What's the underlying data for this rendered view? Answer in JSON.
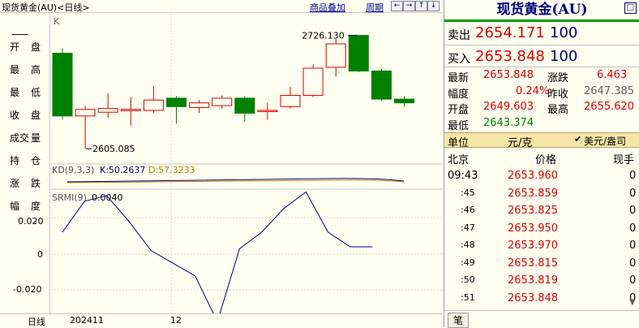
{
  "header": {
    "title": "现货黄金(AU)<日线>",
    "overlay_link": "商品叠加",
    "period_link": "周期",
    "nav_buttons": [
      "←",
      "→",
      "↑",
      "↓",
      "□"
    ]
  },
  "left_panel": {
    "top_label": "K",
    "dash": "------",
    "rows": [
      [
        "开",
        "盘"
      ],
      [
        "最",
        "高"
      ],
      [
        "最",
        "低"
      ],
      [
        "收",
        "盘"
      ],
      [
        "成交",
        "量"
      ],
      [
        "持",
        "仓"
      ],
      [
        "涨",
        "跌"
      ],
      [
        "幅",
        "度"
      ]
    ]
  },
  "bottom_bar": {
    "period_label": "日线",
    "date_label_1": "202411",
    "date_label_2": "12"
  },
  "kline": {
    "high_label": "2726.130",
    "low_label": "2605.085",
    "candles": [
      {
        "o": 2707,
        "h": 2712,
        "l": 2636,
        "c": 2640
      },
      {
        "o": 2640,
        "h": 2651,
        "l": 2605,
        "c": 2647
      },
      {
        "o": 2644,
        "h": 2664,
        "l": 2638,
        "c": 2648
      },
      {
        "o": 2646,
        "h": 2660,
        "l": 2630,
        "c": 2647
      },
      {
        "o": 2646,
        "h": 2672,
        "l": 2643,
        "c": 2657
      },
      {
        "o": 2659,
        "h": 2661,
        "l": 2632,
        "c": 2650
      },
      {
        "o": 2649,
        "h": 2657,
        "l": 2643,
        "c": 2654
      },
      {
        "o": 2651,
        "h": 2662,
        "l": 2648,
        "c": 2659
      },
      {
        "o": 2659,
        "h": 2661,
        "l": 2634,
        "c": 2643
      },
      {
        "o": 2645,
        "h": 2654,
        "l": 2636,
        "c": 2646
      },
      {
        "o": 2650,
        "h": 2671,
        "l": 2648,
        "c": 2662
      },
      {
        "o": 2662,
        "h": 2695,
        "l": 2660,
        "c": 2691
      },
      {
        "o": 2692,
        "h": 2722,
        "l": 2682,
        "c": 2717
      },
      {
        "o": 2726,
        "h": 2726,
        "l": 2687,
        "c": 2688
      },
      {
        "o": 2688,
        "h": 2690,
        "l": 2656,
        "c": 2658
      },
      {
        "o": 2658,
        "h": 2661,
        "l": 2650,
        "c": 2654
      }
    ]
  },
  "kd": {
    "label": "KD(9,3,3)",
    "k_label": "K:50.2637",
    "d_label": "D:57.3233"
  },
  "srmi": {
    "label": "SRMI(9)",
    "value_label": "0.0040",
    "y_ticks": [
      "0.020",
      "0",
      "-0.020"
    ],
    "values": [
      0.012,
      0.029,
      0.032,
      0.018,
      0.002,
      -0.005,
      -0.012,
      -0.037,
      0.003,
      0.012,
      0.025,
      0.034,
      0.012,
      0.004,
      0.004
    ]
  },
  "quote": {
    "title": "现货黄金(AU)",
    "sell_label": "卖出",
    "sell_price": "2654.171",
    "sell_qty": "100",
    "buy_label": "买入",
    "buy_price": "2653.848",
    "buy_qty": "100",
    "latest_label": "最新",
    "latest": "2653.848",
    "change_label": "涨跌",
    "change": "6.463",
    "pct_label": "幅度",
    "pct": "0.24%",
    "prev_label": "昨收",
    "prev": "2647.385",
    "open_label": "开盘",
    "open": "2649.603",
    "high_label": "最高",
    "high": "2655.620",
    "low_label": "最低",
    "low": "2643.374",
    "unit_label": "单位",
    "unit": "元/克",
    "unit_option": "美元/盎司",
    "col_market": "北京",
    "col_price": "价格",
    "col_qty": "现手",
    "ticks": [
      {
        "time": "09:43",
        "price": "2653.960",
        "qty": "0"
      },
      {
        "time": ":45",
        "price": "2653.859",
        "qty": "0"
      },
      {
        "time": ":46",
        "price": "2653.825",
        "qty": "0"
      },
      {
        "time": ":47",
        "price": "2653.950",
        "qty": "0"
      },
      {
        "time": ":48",
        "price": "2653.970",
        "qty": "0"
      },
      {
        "time": ":49",
        "price": "2653.815",
        "qty": "0"
      },
      {
        "time": ":50",
        "price": "2653.819",
        "qty": "0"
      },
      {
        "time": ":51",
        "price": "2653.848",
        "qty": "0"
      }
    ],
    "footer_tab": "笔"
  },
  "colors": {
    "up": "#E00000",
    "down": "#008000",
    "grid": "#C8C8C8",
    "line": "#000080"
  }
}
